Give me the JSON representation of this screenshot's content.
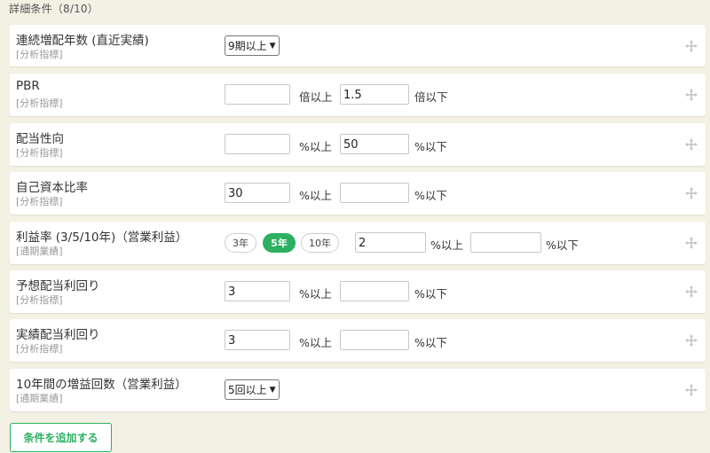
{
  "header": {
    "title": "詳細条件（8/10）"
  },
  "rows": [
    {
      "label": "連続増配年数 (直近実績)",
      "sub": "[分析指標]",
      "select": "9期以上"
    },
    {
      "label": "PBR",
      "sub": "[分析指標]",
      "min": "",
      "min_unit": "倍以上",
      "max": "1.5",
      "max_unit": "倍以下"
    },
    {
      "label": "配当性向",
      "sub": "[分析指標]",
      "min": "",
      "min_unit": "%以上",
      "max": "50",
      "max_unit": "%以下"
    },
    {
      "label": "自己資本比率",
      "sub": "[分析指標]",
      "min": "30",
      "min_unit": "%以上",
      "max": "",
      "max_unit": "%以下"
    },
    {
      "label": "利益率 (3/5/10年)（営業利益）",
      "sub": "[通期業績]",
      "periods": [
        "3年",
        "5年",
        "10年"
      ],
      "active_period": "5年",
      "min": "2",
      "min_unit": "%以上",
      "max": "",
      "max_unit": "%以下"
    },
    {
      "label": "予想配当利回り",
      "sub": "[分析指標]",
      "min": "3",
      "min_unit": "%以上",
      "max": "",
      "max_unit": "%以下"
    },
    {
      "label": "実績配当利回り",
      "sub": "[分析指標]",
      "min": "3",
      "min_unit": "%以上",
      "max": "",
      "max_unit": "%以下"
    },
    {
      "label": "10年間の増益回数（営業利益）",
      "sub": "[通期業績]",
      "select": "5回以上"
    }
  ],
  "add_button": {
    "label": "条件を追加する"
  },
  "icons": {
    "drag": "move-icon",
    "dropdown": "chevron-down-icon"
  },
  "colors": {
    "accent": "#2bb061",
    "background": "#f3f0e4"
  }
}
